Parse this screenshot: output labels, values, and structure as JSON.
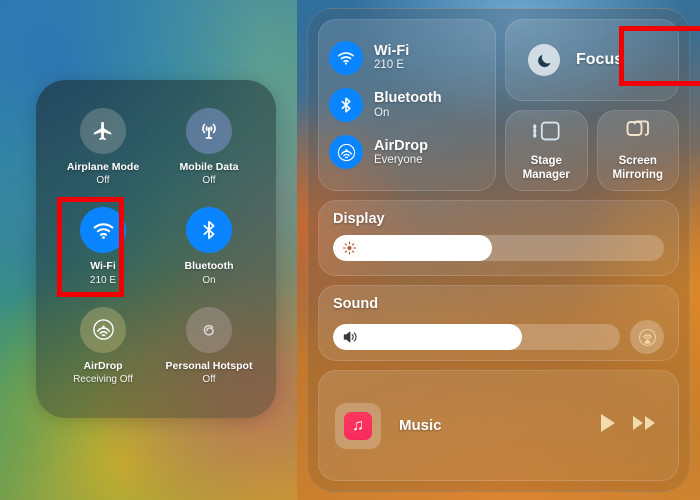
{
  "left_panel": {
    "name": "iphone-control-center",
    "tiles": [
      {
        "id": "airplane-mode",
        "label": "Airplane Mode",
        "status": "Off",
        "icon": "airplane-icon",
        "state": "off"
      },
      {
        "id": "mobile-data",
        "label": "Mobile Data",
        "status": "Off",
        "icon": "cellular-antenna-icon",
        "state": "off"
      },
      {
        "id": "wifi",
        "label": "Wi-Fi",
        "status": "210 E",
        "icon": "wifi-icon",
        "state": "on"
      },
      {
        "id": "bluetooth",
        "label": "Bluetooth",
        "status": "On",
        "icon": "bluetooth-icon",
        "state": "on"
      },
      {
        "id": "airdrop",
        "label": "AirDrop",
        "status": "Receiving Off",
        "icon": "airdrop-icon",
        "state": "off"
      },
      {
        "id": "hotspot",
        "label": "Personal Hotspot",
        "status": "Off",
        "icon": "hotspot-icon",
        "state": "off"
      }
    ]
  },
  "right_panel": {
    "name": "ipad-control-center",
    "connectivity": [
      {
        "id": "wifi",
        "title": "Wi-Fi",
        "sub": "210 E",
        "icon": "wifi-icon"
      },
      {
        "id": "bluetooth",
        "title": "Bluetooth",
        "sub": "On",
        "icon": "bluetooth-icon"
      },
      {
        "id": "airdrop",
        "title": "AirDrop",
        "sub": "Everyone",
        "icon": "airdrop-icon"
      }
    ],
    "focus": {
      "label": "Focus",
      "icon": "moon-icon"
    },
    "mini_tiles": [
      {
        "id": "stage-manager",
        "label": "Stage Manager",
        "icon": "stage-manager-icon"
      },
      {
        "id": "screen-mirroring",
        "label": "Screen Mirroring",
        "icon": "screen-mirroring-icon"
      }
    ],
    "display_slider": {
      "title": "Display",
      "icon": "brightness-icon",
      "value": 48
    },
    "sound_slider": {
      "title": "Sound",
      "icon": "speaker-icon",
      "value": 66,
      "airplay_icon": "airplay-audio-icon"
    },
    "music": {
      "label": "Music",
      "app_icon": "music-note-icon",
      "play_icon": "play-icon",
      "next_icon": "fast-forward-icon"
    }
  },
  "highlights": {
    "color": "#f00000",
    "targets": [
      "left-wifi-tile",
      "right-wifi-row"
    ]
  },
  "colors": {
    "accent_blue": "#0a84ff",
    "highlight_red": "#f00000",
    "music_pink": "#fb3a5d"
  }
}
